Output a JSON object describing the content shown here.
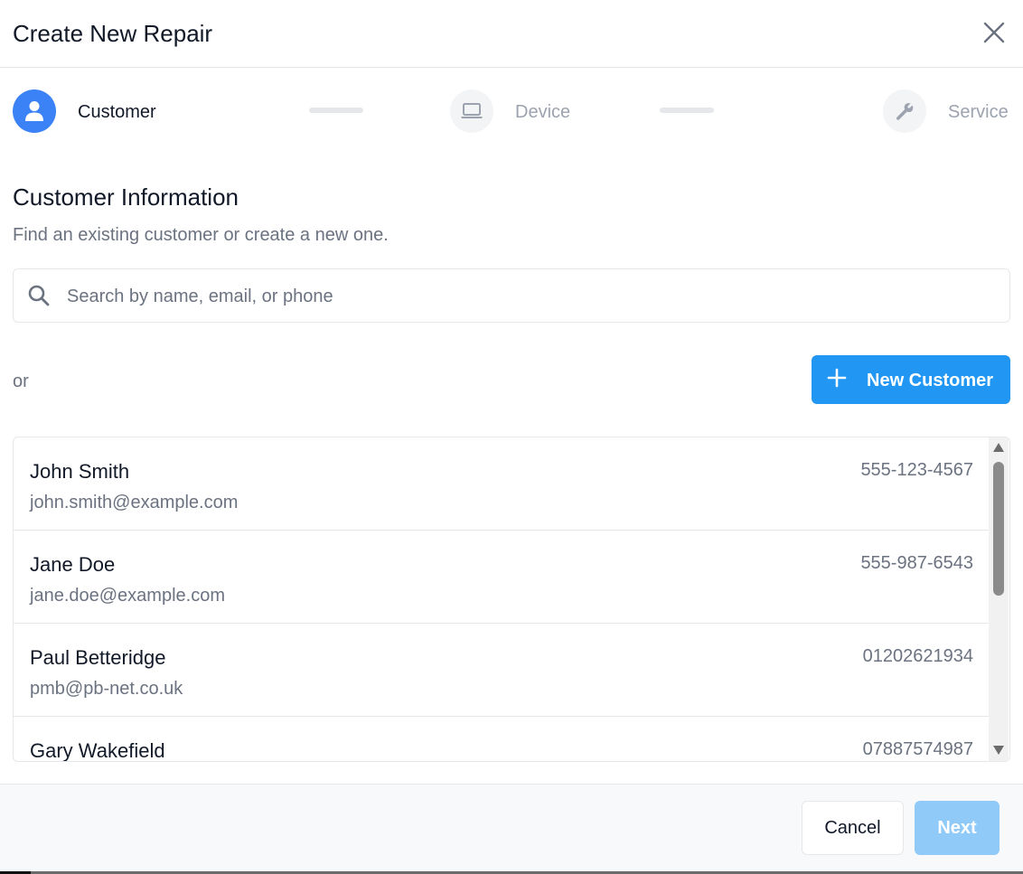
{
  "dialog": {
    "title": "Create New Repair",
    "close_icon": "close-icon"
  },
  "stepper": {
    "steps": [
      {
        "label": "Customer",
        "icon": "user-icon",
        "state": "active"
      },
      {
        "label": "Device",
        "icon": "laptop-icon",
        "state": "inactive"
      },
      {
        "label": "Service",
        "icon": "wrench-icon",
        "state": "inactive"
      }
    ]
  },
  "section": {
    "title": "Customer Information",
    "subtitle": "Find an existing customer or create a new one."
  },
  "search": {
    "placeholder": "Search by name, email, or phone",
    "value": "",
    "icon": "search-icon"
  },
  "or_text": "or",
  "new_customer": {
    "label": "New Customer",
    "icon": "plus-icon"
  },
  "customers": [
    {
      "name": "John Smith",
      "email": "john.smith@example.com",
      "phone": "555-123-4567"
    },
    {
      "name": "Jane Doe",
      "email": "jane.doe@example.com",
      "phone": "555-987-6543"
    },
    {
      "name": "Paul Betteridge",
      "email": "pmb@pb-net.co.uk",
      "phone": "01202621934"
    },
    {
      "name": "Gary Wakefield",
      "email": "",
      "phone": "07887574987"
    }
  ],
  "footer": {
    "cancel_label": "Cancel",
    "next_label": "Next"
  },
  "colors": {
    "primary": "#2196f3",
    "step_active": "#3b82f6",
    "next_disabled": "#90caf9",
    "muted_text": "#6b7280"
  }
}
